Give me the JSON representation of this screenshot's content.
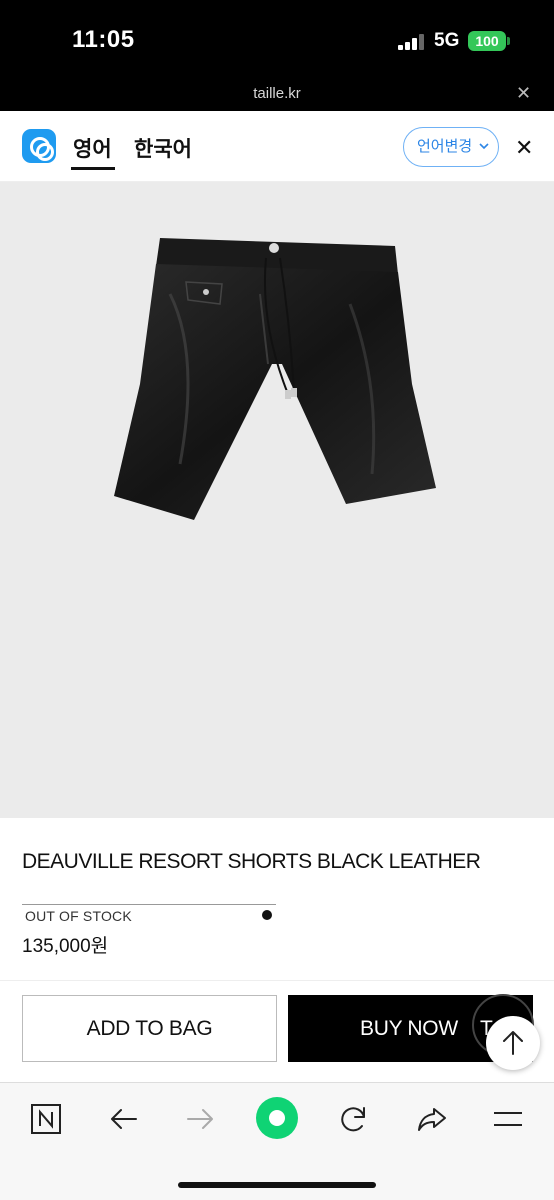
{
  "status_bar": {
    "time": "11:05",
    "network": "5G",
    "battery": "100"
  },
  "browser": {
    "url": "taille.kr"
  },
  "translate_bar": {
    "source_lang": "영어",
    "target_lang": "한국어",
    "change_label": "언어변경"
  },
  "product": {
    "name": "DEAUVILLE RESORT SHORTS BLACK LEATHER",
    "stock_status": "OUT OF STOCK",
    "price": "135,000원"
  },
  "actions": {
    "add_to_bag": "ADD TO BAG",
    "buy_now": "BUY NOW",
    "buy_partial": "T"
  },
  "colors": {
    "papago_blue": "#1f9bf0",
    "naver_green": "#0fd374",
    "battery_green": "#34c759"
  }
}
